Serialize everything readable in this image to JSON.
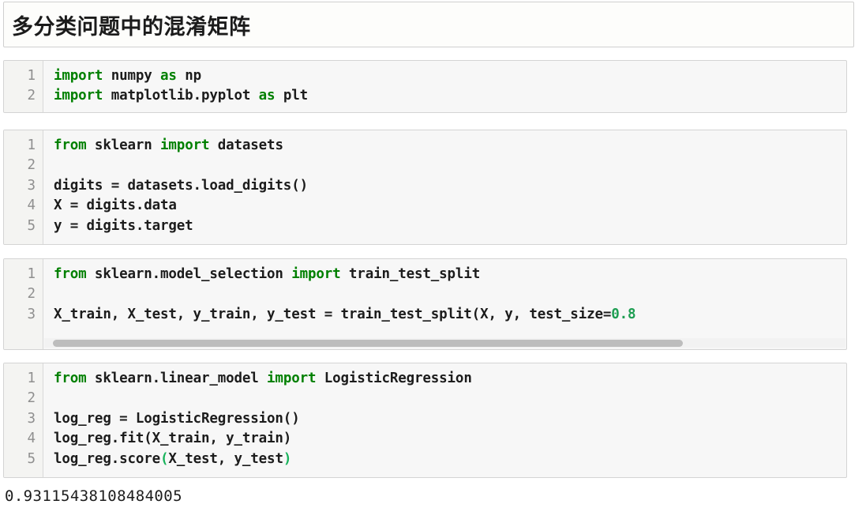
{
  "notebook": {
    "title_cell": {
      "text": "多分类问题中的混淆矩阵"
    },
    "output": {
      "value": "0.93115438108484005"
    },
    "colors": {
      "keyword_green": "#008000",
      "number_green": "#1e9e52",
      "paren_green": "#19b35c",
      "code_text": "#1c1c1c",
      "linenumber": "#8f8f8f",
      "cell_background": "#f7f7f7",
      "gutter_background": "#f4f4f2",
      "cell_border": "#d4d4d4",
      "scrollbar_thumb": "#bdbdbd"
    },
    "cells": [
      {
        "id": "cell-1",
        "line_numbers": [
          "1",
          "2"
        ],
        "lines": [
          [
            {
              "t": "import",
              "c": "kw"
            },
            {
              "t": " numpy ",
              "c": ""
            },
            {
              "t": "as",
              "c": "kw"
            },
            {
              "t": " np",
              "c": ""
            }
          ],
          [
            {
              "t": "import",
              "c": "kw"
            },
            {
              "t": " matplotlib.pyplot ",
              "c": ""
            },
            {
              "t": "as",
              "c": "kw"
            },
            {
              "t": " plt",
              "c": ""
            }
          ]
        ],
        "scrollbar": false
      },
      {
        "id": "cell-2",
        "line_numbers": [
          "1",
          "2",
          "3",
          "4",
          "5"
        ],
        "lines": [
          [
            {
              "t": "from",
              "c": "kw"
            },
            {
              "t": " sklearn ",
              "c": ""
            },
            {
              "t": "import",
              "c": "kw"
            },
            {
              "t": " datasets",
              "c": ""
            }
          ],
          [
            {
              "t": "",
              "c": ""
            }
          ],
          [
            {
              "t": "digits = datasets.load_digits()",
              "c": ""
            }
          ],
          [
            {
              "t": "X = digits.data",
              "c": ""
            }
          ],
          [
            {
              "t": "y = digits.target",
              "c": ""
            }
          ]
        ],
        "scrollbar": false
      },
      {
        "id": "cell-3",
        "line_numbers": [
          "1",
          "2",
          "3"
        ],
        "lines": [
          [
            {
              "t": "from",
              "c": "kw"
            },
            {
              "t": " sklearn.model_selection ",
              "c": ""
            },
            {
              "t": "import",
              "c": "kw"
            },
            {
              "t": " train_test_split",
              "c": ""
            }
          ],
          [
            {
              "t": "",
              "c": ""
            }
          ],
          [
            {
              "t": "X_train, X_test, y_train, y_test = train_test_split(X, y, test_size=",
              "c": ""
            },
            {
              "t": "0.8",
              "c": "num"
            }
          ]
        ],
        "scrollbar": true
      },
      {
        "id": "cell-4",
        "line_numbers": [
          "1",
          "2",
          "3",
          "4",
          "5"
        ],
        "lines": [
          [
            {
              "t": "from",
              "c": "kw"
            },
            {
              "t": " sklearn.linear_model ",
              "c": ""
            },
            {
              "t": "import",
              "c": "kw"
            },
            {
              "t": " LogisticRegression",
              "c": ""
            }
          ],
          [
            {
              "t": "",
              "c": ""
            }
          ],
          [
            {
              "t": "log_reg = LogisticRegression()",
              "c": ""
            }
          ],
          [
            {
              "t": "log_reg.fit(X_train, y_train)",
              "c": ""
            }
          ],
          [
            {
              "t": "log_reg.score",
              "c": ""
            },
            {
              "t": "(",
              "c": "pn"
            },
            {
              "t": "X_test, y_test",
              "c": ""
            },
            {
              "t": ")",
              "c": "pn"
            }
          ]
        ],
        "scrollbar": false
      }
    ]
  }
}
